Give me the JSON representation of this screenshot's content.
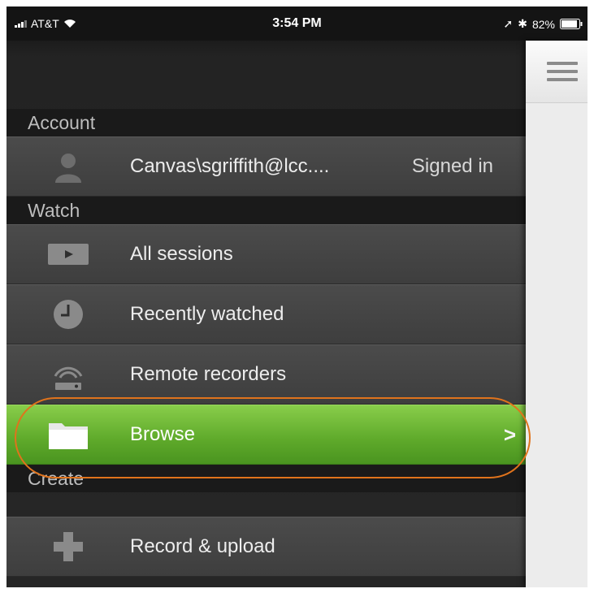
{
  "status_bar": {
    "carrier": "AT&T",
    "time": "3:54 PM",
    "battery": "82%"
  },
  "menu": {
    "sections": [
      {
        "title": "Account"
      },
      {
        "title": "Watch"
      },
      {
        "title": "Create"
      }
    ],
    "account_row": {
      "label": "Canvas\\sgriffith@lcc....",
      "status": "Signed in",
      "icon": "person-icon"
    },
    "watch_items": [
      {
        "label": "All sessions",
        "icon": "play-icon"
      },
      {
        "label": "Recently watched",
        "icon": "clock-icon"
      },
      {
        "label": "Remote recorders",
        "icon": "recorder-icon"
      },
      {
        "label": "Browse",
        "icon": "folder-icon",
        "chevron": ">"
      }
    ],
    "create_items": [
      {
        "label": "Record & upload",
        "icon": "plus-icon"
      }
    ]
  },
  "colors": {
    "active": "#5ea92a",
    "highlight": "#e0731c",
    "menu_bg": "#2b2b2b"
  }
}
